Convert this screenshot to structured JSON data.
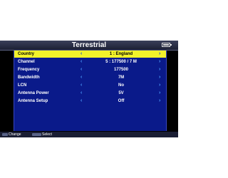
{
  "header": {
    "title": "Terrestrial"
  },
  "settings": [
    {
      "label": "Country",
      "value": "1 : England",
      "selected": true
    },
    {
      "label": "Channel",
      "value": "5 : 177500 / 7 M",
      "selected": false
    },
    {
      "label": "Frequency",
      "value": "177500",
      "selected": false
    },
    {
      "label": "Bandwidth",
      "value": "7M",
      "selected": false
    },
    {
      "label": "LCN",
      "value": "No",
      "selected": false
    },
    {
      "label": "Antenna Power",
      "value": "5V",
      "selected": false
    },
    {
      "label": "Antenna Setup",
      "value": "Off",
      "selected": false
    }
  ],
  "arrows": {
    "left": "‹",
    "right": "›"
  },
  "footer": {
    "change_label": "Change",
    "select_label": "Select"
  },
  "icons": [
    "battery-icon",
    "left-arrow-icon",
    "right-arrow-icon",
    "remote-key-icon"
  ],
  "colors": {
    "panel": "#0a1a8a",
    "highlight": "#f2f22a",
    "arrow": "#4ea0ff"
  }
}
